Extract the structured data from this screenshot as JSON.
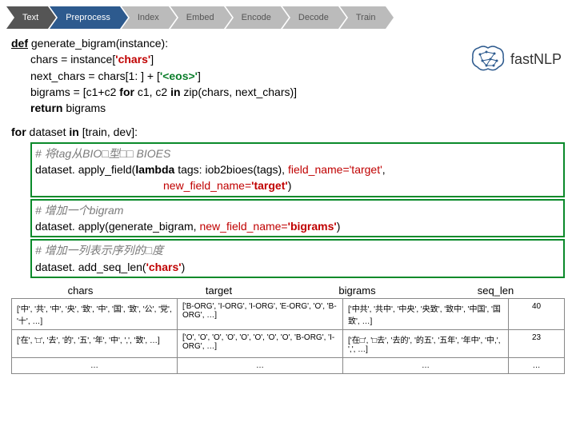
{
  "pipeline": [
    "Text",
    "Preprocess",
    "Index",
    "Embed",
    "Encode",
    "Decode",
    "Train"
  ],
  "logo": "fastNLP",
  "code": {
    "l1a": "def",
    "l1b": " generate_bigram(instance):",
    "l2a": "chars = instance[",
    "l2b": "'chars'",
    "l2c": "]",
    "l3a": "next_chars = chars[1: ] + [",
    "l3b": "'<eos>'",
    "l3c": "]",
    "l4a": "bigrams = [c1+c2 ",
    "l4b": "for",
    "l4c": " c1, c2 ",
    "l4d": "in",
    "l4e": " zip(chars, next_chars)]",
    "l5a": "return",
    "l5b": " bigrams",
    "l6a": "for",
    "l6b": " dataset ",
    "l6c": "in",
    "l6d": " [train, dev]:",
    "l7": "# 将tag从BIO□型□□ BIOES",
    "l8a": "dataset. apply_field(",
    "l8b": "lambda",
    "l8c": " tags: iob2bioes(tags), ",
    "l8d": "field_name='target'",
    "l8e": ",",
    "l9a": "new_field_name=",
    "l9b": "'target'",
    "l9c": ")",
    "l10": "# 增加一个bigram",
    "l11a": "dataset. apply(generate_bigram, ",
    "l11b": "new_field_name=",
    "l11c": "'bigrams'",
    "l11d": ")",
    "l12": "# 增加一列表示序列的□度",
    "l13a": "dataset. add_seq_len(",
    "l13b": "'chars'",
    "l13c": ")"
  },
  "headers": [
    "chars",
    "target",
    "bigrams",
    "seq_len"
  ],
  "rows": [
    {
      "chars": "['中', '共', '中', '央', '致', '中', '国', '致', '公', '党', '十', …]",
      "target": "['B-ORG', 'I-ORG', 'I-ORG', 'E-ORG', 'O', 'B-ORG', …]",
      "bigrams": "['中共', '共中', '中央', '央致', '致中', '中国', '国致', …]",
      "seq": "40"
    },
    {
      "chars": "['在', '□', '去', '的', '五', '年', '中', ',', '致', …]",
      "target": "['O', 'O', 'O', 'O', 'O', 'O', 'O', 'O', 'B-ORG', 'I-ORG', …]",
      "bigrams": "['在□', '□去', '去的', '的五', '五年', '年中', '中,', ',', …]",
      "seq": "23"
    },
    {
      "chars": "…",
      "target": "…",
      "bigrams": "…",
      "seq": "…"
    }
  ]
}
